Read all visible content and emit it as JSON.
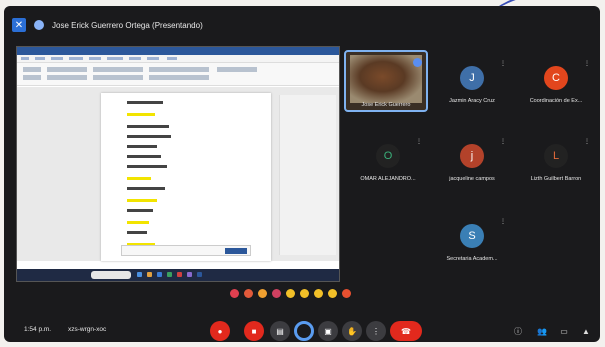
{
  "presenting_title": "Jose Erick Guerrero Ortega (Presentando)",
  "participants": [
    {
      "name": "Jose Erick Guerrero",
      "initial": "",
      "color": "#5a3a24"
    },
    {
      "name": "Jazmin Aracy Cruz",
      "initial": "J",
      "color": "#3f6fa8"
    },
    {
      "name": "Coordinación de Ex...",
      "initial": "C",
      "color": "#e2461d"
    },
    {
      "name": "OMAR ALEJANDRO...",
      "initial": "O",
      "color": "#2a2a2a"
    },
    {
      "name": "jacqueline campos",
      "initial": "j",
      "color": "#b3422a"
    },
    {
      "name": "Lizth Guilbert Barron",
      "initial": "L",
      "color": "#2a2a2a"
    },
    {
      "name": "Secretaria Academ...",
      "initial": "S",
      "color": "#3a7fb5"
    }
  ],
  "meeting": {
    "time": "1:54 p.m.",
    "code": "xzs-wrgn-xoc"
  },
  "colors": {
    "mic_red": "#e2291d",
    "accent_blue": "#5a9cf0",
    "background": "#1a1a1c"
  },
  "icons": {
    "mic": "microphone-off-icon",
    "camera": "camera-off-icon",
    "captions": "captions-icon",
    "present": "present-icon",
    "hand": "raise-hand-icon",
    "more": "more-options-icon",
    "end": "end-call-icon",
    "info": "info-icon",
    "people": "people-icon",
    "chat": "chat-icon",
    "activities": "activities-icon"
  }
}
